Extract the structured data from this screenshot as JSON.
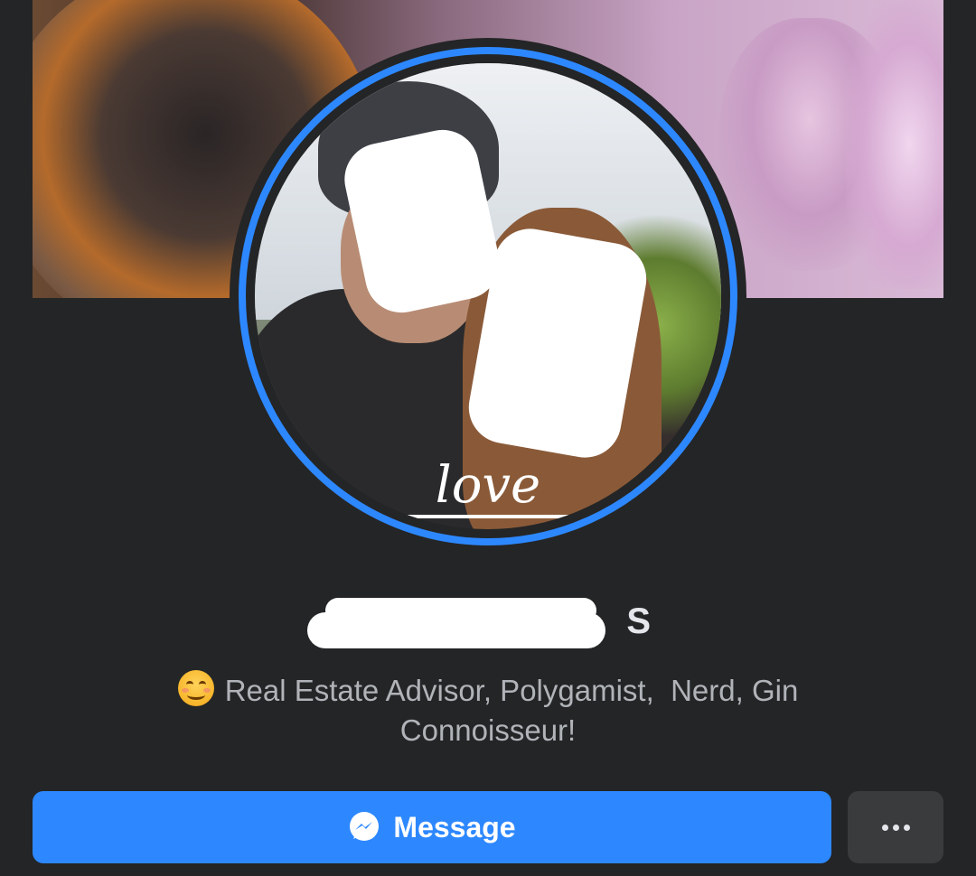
{
  "profile": {
    "avatar_overlay_text": "love",
    "name_visible_fragment": "S",
    "bio": "Real Estate Advisor, Polygamist,  Nerd, Gin\nConnoisseur!",
    "bio_emoji": "smiling-face-emoji"
  },
  "actions": {
    "message_label": "Message",
    "message_icon": "messenger-icon",
    "more_icon": "more-dots-icon"
  },
  "colors": {
    "background": "#242526",
    "accent": "#2d88ff",
    "secondary_button": "#3a3b3c",
    "primary_text": "#e4e6eb",
    "secondary_text": "#b0b3b8"
  }
}
